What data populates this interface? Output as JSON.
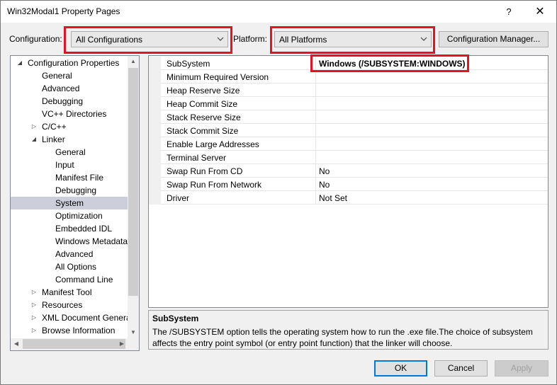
{
  "window": {
    "title": "Win32Modal1 Property Pages",
    "help_glyph": "?",
    "close_glyph": "✕"
  },
  "toolbar": {
    "configuration_label": "Configuration:",
    "configuration_value": "All Configurations",
    "platform_label": "Platform:",
    "platform_value": "All Platforms",
    "config_manager_label": "Configuration Manager..."
  },
  "tree": {
    "items": [
      {
        "label": "Configuration Properties",
        "expander": "◢"
      },
      {
        "label": "General"
      },
      {
        "label": "Advanced"
      },
      {
        "label": "Debugging"
      },
      {
        "label": "VC++ Directories"
      },
      {
        "label": "C/C++",
        "expander": "▷"
      },
      {
        "label": "Linker",
        "expander": "◢"
      },
      {
        "label": "General"
      },
      {
        "label": "Input"
      },
      {
        "label": "Manifest File"
      },
      {
        "label": "Debugging"
      },
      {
        "label": "System",
        "selected": true
      },
      {
        "label": "Optimization"
      },
      {
        "label": "Embedded IDL"
      },
      {
        "label": "Windows Metadata"
      },
      {
        "label": "Advanced"
      },
      {
        "label": "All Options"
      },
      {
        "label": "Command Line"
      },
      {
        "label": "Manifest Tool",
        "expander": "▷"
      },
      {
        "label": "Resources",
        "expander": "▷"
      },
      {
        "label": "XML Document Genera",
        "expander": "▷"
      },
      {
        "label": "Browse Information",
        "expander": "▷"
      }
    ]
  },
  "properties": {
    "rows": [
      {
        "name": "SubSystem",
        "value": "Windows (/SUBSYSTEM:WINDOWS)"
      },
      {
        "name": "Minimum Required Version",
        "value": ""
      },
      {
        "name": "Heap Reserve Size",
        "value": ""
      },
      {
        "name": "Heap Commit Size",
        "value": ""
      },
      {
        "name": "Stack Reserve Size",
        "value": ""
      },
      {
        "name": "Stack Commit Size",
        "value": ""
      },
      {
        "name": "Enable Large Addresses",
        "value": ""
      },
      {
        "name": "Terminal Server",
        "value": ""
      },
      {
        "name": "Swap Run From CD",
        "value": "No"
      },
      {
        "name": "Swap Run From Network",
        "value": "No"
      },
      {
        "name": "Driver",
        "value": "Not Set"
      }
    ]
  },
  "description": {
    "title": "SubSystem",
    "text": "The /SUBSYSTEM option tells the operating system how to run the .exe file.The choice of subsystem affects the entry point symbol (or entry point function) that the linker will choose."
  },
  "buttons": {
    "ok": "OK",
    "cancel": "Cancel",
    "apply": "Apply"
  },
  "colors": {
    "highlight": "#e81123",
    "selection": "#cccedb",
    "accent": "#0078d7"
  }
}
